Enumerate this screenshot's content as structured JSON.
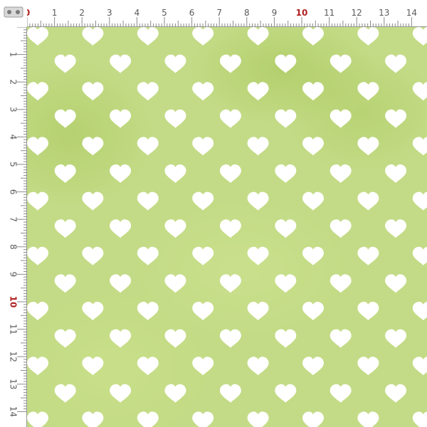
{
  "ruler": {
    "unit_labels_top": [
      "0",
      "1",
      "2",
      "3",
      "4",
      "5",
      "6",
      "7",
      "8",
      "9",
      "10",
      "11",
      "12",
      "13",
      "14"
    ],
    "unit_labels_left": [
      "1",
      "2",
      "3",
      "4",
      "5",
      "6",
      "7",
      "8",
      "9",
      "10",
      "11",
      "12",
      "13",
      "14"
    ],
    "accent_labels": [
      "0",
      "10"
    ]
  },
  "pattern": {
    "motif": "heart-icon",
    "motif_color": "#ffffff",
    "background_color": "#c3db86",
    "accent_color": "#b02020"
  }
}
